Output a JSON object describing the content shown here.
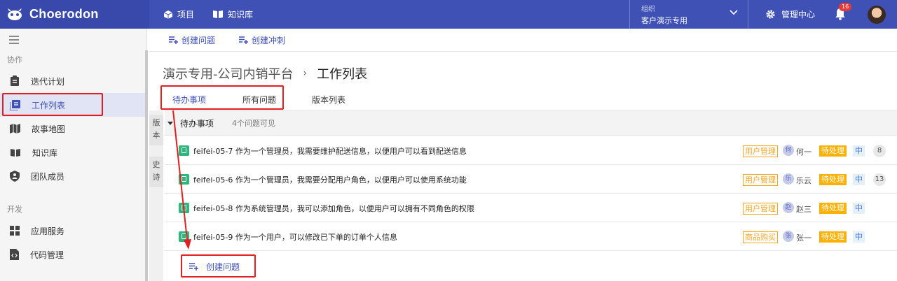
{
  "app": {
    "name": "Choerodon"
  },
  "topnav": [
    {
      "label": "项目",
      "icon": "cube-icon"
    },
    {
      "label": "知识库",
      "icon": "book-icon"
    }
  ],
  "org": {
    "label": "组织",
    "value": "客户演示专用"
  },
  "admin_center": "管理中心",
  "notifications": {
    "count": "16"
  },
  "sidebar": {
    "sections": [
      {
        "title": "协作",
        "items": [
          {
            "label": "迭代计划",
            "icon": "clipboard-icon"
          },
          {
            "label": "工作列表",
            "icon": "list-book-icon",
            "active": true
          },
          {
            "label": "故事地图",
            "icon": "map-icon"
          },
          {
            "label": "知识库",
            "icon": "open-book-icon"
          },
          {
            "label": "团队成员",
            "icon": "shield-user-icon"
          }
        ]
      },
      {
        "title": "开发",
        "items": [
          {
            "label": "应用服务",
            "icon": "apps-icon"
          },
          {
            "label": "代码管理",
            "icon": "code-file-icon"
          }
        ]
      }
    ]
  },
  "toolbar": {
    "create_issue": "创建问题",
    "create_sprint": "创建冲刺"
  },
  "breadcrumb": {
    "project": "演示专用-公司内销平台",
    "separator": "›",
    "current": "工作列表"
  },
  "tabs": [
    {
      "label": "待办事项",
      "active": true
    },
    {
      "label": "所有问题"
    },
    {
      "label": "版本列表"
    }
  ],
  "side_tabs": [
    "版本",
    "史诗"
  ],
  "backlog": {
    "title": "待办事项",
    "count_text": "4个问题可见",
    "issues": [
      {
        "key": "feifei-05-7",
        "summary": "作为一个管理员，我需要维护配送信息，以便用户可以看到配送信息",
        "epic": "用户管理",
        "assignee_initial": "何",
        "assignee": "何一",
        "status": "待处理",
        "priority": "中",
        "points": "8"
      },
      {
        "key": "feifei-05-6",
        "summary": "作为一个管理员，我需要分配用户角色，以便用户可以使用系统功能",
        "epic": "用户管理",
        "assignee_initial": "乐",
        "assignee": "乐云",
        "status": "待处理",
        "priority": "中",
        "points": "13"
      },
      {
        "key": "feifei-05-8",
        "summary": "作为系统管理员，我可以添加角色，以便用户可以拥有不同角色的权限",
        "epic": "用户管理",
        "assignee_initial": "赵",
        "assignee": "赵三",
        "status": "待处理",
        "priority": "中",
        "points": ""
      },
      {
        "key": "feifei-05-9",
        "summary": "作为一个用户，可以修改已下单的订单个人信息",
        "epic": "商品购买",
        "assignee_initial": "张",
        "assignee": "张一",
        "status": "待处理",
        "priority": "中",
        "points": ""
      }
    ],
    "create_issue": "创建问题"
  },
  "colors": {
    "primary": "#3f51b5",
    "header_dark": "#3949ab",
    "highlight_red": "#e02020",
    "status_orange": "#ffb100",
    "epic_orange": "#f5a623",
    "issue_green": "#2eb67d"
  }
}
